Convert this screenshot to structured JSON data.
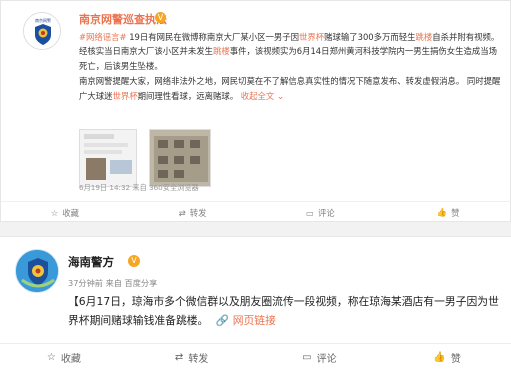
{
  "post1": {
    "author": "南京网警巡查执法",
    "verified_icon": "v-badge-icon",
    "avatar_icon": "police-badge-icon",
    "paragraph1_prefix": "#网络谣言#",
    "paragraph1_part1": " 19日有网民在微博称南京大厂某小区一男子因",
    "paragraph1_hl1": "世界杯",
    "paragraph1_part2": "赌球输了300多万而轻生",
    "paragraph1_hl2": "跳楼",
    "paragraph1_part3": "自杀并附有视频。经核实当日南京大厂该小区并未发生",
    "paragraph1_hl3": "跳楼",
    "paragraph1_part4": "事件，该视频实为6月14日郑州黄河科技学院内一男生捐伤女生造成当场死亡，后该男生坠楼。",
    "paragraph2": "南京网警提醒大家，网络非法外之地，网民切莫在不了解信息真实性的情况下随意发布、转发虚假消息。 同时提醒广大球迷",
    "paragraph2_hl": "世界杯",
    "paragraph2_end": "期间理性看球，远离赌球。",
    "expand_link": "收起全文",
    "timestamp": "6月19日 14:32 来自 360安全浏览器",
    "actions": {
      "favorite": "收藏",
      "repost": "转发",
      "comment": "评论",
      "like": "赞"
    }
  },
  "post2": {
    "author": "海南警方",
    "verified_icon": "v-badge-icon",
    "avatar_icon": "police-emblem-icon",
    "meta": "37分钟前 来自 百度分享",
    "body": "【6月17日，琼海市多个微信群以及朋友圈流传一段视频，称在琼海某酒店有一男子因为世界杯期间赌球输钱准备跳楼。",
    "link_label": "网页链接",
    "actions": {
      "favorite": "收藏",
      "repost": "转发",
      "comment": "评论",
      "like": "赞"
    }
  },
  "colors": {
    "accent": "#eb7350",
    "badge": "#f5a623"
  }
}
